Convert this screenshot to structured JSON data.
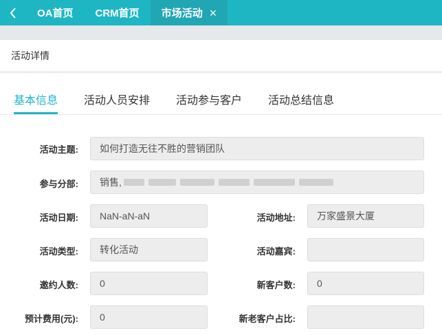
{
  "top_tabs": [
    {
      "label": "OA首页"
    },
    {
      "label": "CRM首页"
    },
    {
      "label": "市场活动"
    }
  ],
  "page_header": {
    "title": "活动详情"
  },
  "detail_tabs": [
    {
      "label": "基本信息"
    },
    {
      "label": "活动人员安排"
    },
    {
      "label": "活动参与客户"
    },
    {
      "label": "活动总结信息"
    }
  ],
  "form": {
    "theme": {
      "label": "活动主题:",
      "value": "如何打造无往不胜的营销团队"
    },
    "branch": {
      "label": "参与分部:",
      "value": "销售,"
    },
    "date": {
      "label": "活动日期:",
      "value": "NaN-aN-aN"
    },
    "address": {
      "label": "活动地址:",
      "value": "万家盛景大厦"
    },
    "type": {
      "label": "活动类型:",
      "value": "转化活动"
    },
    "guests": {
      "label": "活动嘉宾:",
      "value": ""
    },
    "invited": {
      "label": "邀约人数:",
      "value": "0"
    },
    "new_customers": {
      "label": "新客户数:",
      "value": "0"
    },
    "budget": {
      "label": "预计费用(元):",
      "value": "0"
    },
    "old_new_ratio": {
      "label": "新老客户占比:",
      "value": ""
    }
  },
  "colors": {
    "accent": "#1fb6c4",
    "field_bg": "#ededed"
  }
}
